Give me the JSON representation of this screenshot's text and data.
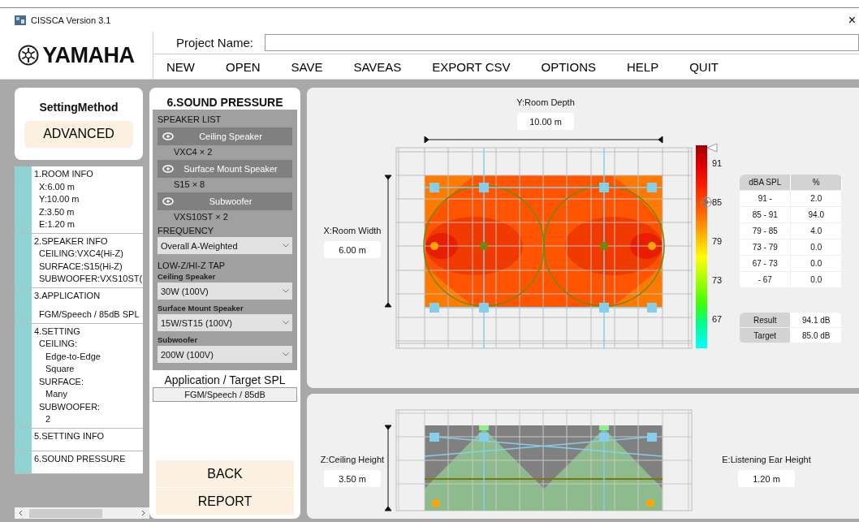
{
  "window": {
    "title": "CISSCA Version 3.1",
    "close": "×"
  },
  "header": {
    "logo": "YAMAHA",
    "project_label": "Project Name:",
    "menu": [
      "NEW",
      "OPEN",
      "SAVE",
      "SAVEAS",
      "EXPORT CSV",
      "OPTIONS",
      "HELP",
      "QUIT"
    ]
  },
  "setting_method": {
    "title": "SettingMethod",
    "value": "ADVANCED"
  },
  "steps": [
    {
      "title": "1.ROOM INFO",
      "lines": [
        {
          "text": "X:6.00 m"
        },
        {
          "text": "Y:10.00 m"
        },
        {
          "text": "Z:3.50 m"
        },
        {
          "text": "E:1.20 m"
        }
      ]
    },
    {
      "title": "2.SPEAKER INFO",
      "lines": [
        {
          "text": "CEILING:VXC4(Hi-Z)"
        },
        {
          "text": "SURFACE:S15(Hi-Z)"
        },
        {
          "text": "SUBWOOFER:VXS10ST("
        }
      ]
    },
    {
      "title": "3.APPLICATION",
      "lines": [
        {
          "text": "FGM/Speech / 85dB SPL"
        }
      ]
    },
    {
      "title": "4.SETTING",
      "lines": [
        {
          "text": "CEILING:",
          "children": [
            {
              "text": "Edge-to-Edge"
            },
            {
              "text": "Square"
            }
          ]
        },
        {
          "text": "SURFACE:",
          "children": [
            {
              "text": "Many"
            }
          ]
        },
        {
          "text": "SUBWOOFER:",
          "children": [
            {
              "text": "2"
            }
          ]
        }
      ]
    },
    {
      "title": "5.SETTING INFO"
    },
    {
      "title": "6.SOUND PRESSURE"
    }
  ],
  "sound_pressure": {
    "title": "6.SOUND PRESSURE",
    "speaker_list_label": "SPEAKER LIST",
    "speakers": [
      {
        "name": "Ceiling Speaker",
        "count": "VXC4 × 2",
        "visible": true
      },
      {
        "name": "Surface Mount Speaker",
        "count": "S15 × 8",
        "visible": true
      },
      {
        "name": "Subwoofer",
        "count": "VXS10ST × 2",
        "visible": true
      }
    ],
    "frequency_label": "FREQUENCY",
    "frequency": "Overall A-Weighted",
    "tap_label": "LOW-Z/HI-Z TAP",
    "taps": [
      {
        "label": "Ceiling Speaker",
        "value": "30W (100V)"
      },
      {
        "label": "Surface Mount Speaker",
        "value": "15W/ST15 (100V)"
      },
      {
        "label": "Subwoofer",
        "value": "200W (100V)"
      }
    ],
    "application_label": "Application / Target SPL",
    "application_value": "FGM/Speech / 85dB",
    "buttons": [
      "BACK",
      "REPORT"
    ]
  },
  "plan_view": {
    "depth_label": "Y:Room Depth",
    "depth_value": "10.00 m",
    "width_label": "X:Room Width",
    "width_value": "6.00 m",
    "scale_ticks": [
      "91",
      "85",
      "79",
      "73",
      "67"
    ],
    "spl_table": {
      "columns": [
        "dBA SPL",
        "%"
      ],
      "rows": [
        [
          "91 -",
          "2.0"
        ],
        [
          "85 - 91",
          "94.0"
        ],
        [
          "79 - 85",
          "4.0"
        ],
        [
          "73 - 79",
          "0.0"
        ],
        [
          "67 - 73",
          "0.0"
        ],
        [
          "- 67",
          "0.0"
        ]
      ]
    },
    "results": [
      {
        "label": "Result",
        "value": "94.1 dB"
      },
      {
        "label": "Target",
        "value": "85.0 dB"
      }
    ]
  },
  "section_view": {
    "height_label": "Z:Ceiling Height",
    "height_value": "3.50 m",
    "ear_label": "E:Listening Ear Height",
    "ear_value": "1.20 m"
  }
}
